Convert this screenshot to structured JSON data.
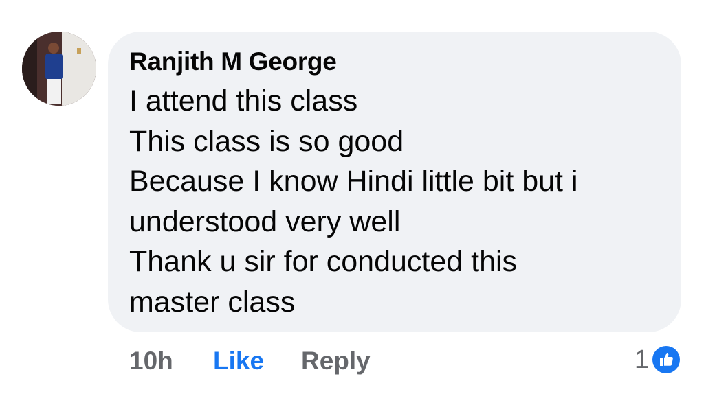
{
  "comment": {
    "author": "Ranjith M George",
    "lines": [
      "I attend this class",
      "This class is so good",
      "Because I know Hindi little bit but i",
      "understood very well",
      "Thank u sir for conducted this",
      "master class"
    ]
  },
  "actions": {
    "time": "10h",
    "like_label": "Like",
    "reply_label": "Reply"
  },
  "reactions": {
    "count": "1",
    "icon": "thumbs-up-icon"
  },
  "colors": {
    "bubble": "#f0f2f5",
    "like_blue": "#1877f2",
    "muted_text": "#65676b"
  }
}
